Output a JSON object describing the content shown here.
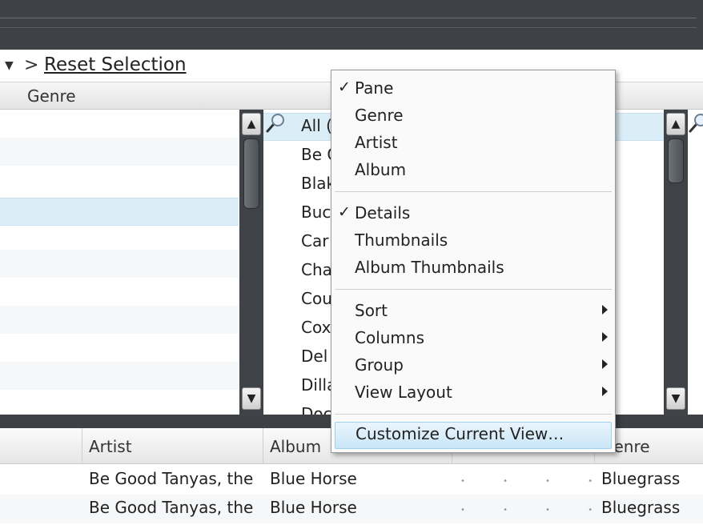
{
  "breadcrumb": {
    "separator": ">",
    "reset_label": "Reset Selection"
  },
  "panes": {
    "genre_header": "Genre",
    "artist_items": [
      "All (",
      "Be G",
      "Blak",
      "Buc",
      "Car",
      "Cha",
      "Cou",
      "Cox",
      "Del",
      "Dilla",
      "Doc"
    ]
  },
  "table": {
    "columns": [
      "Artist",
      "Album",
      "",
      "Genre"
    ],
    "rows": [
      {
        "artist": "Be Good Tanyas, the",
        "album": "Blue Horse",
        "rating_dots": "• • • • •",
        "genre": "Bluegrass"
      },
      {
        "artist": "Be Good Tanyas, the",
        "album": "Blue Horse",
        "rating_dots": "• • • • •",
        "genre": "Bluegrass"
      }
    ]
  },
  "context_menu": {
    "check_mark": "✓",
    "group1": [
      {
        "label": "Pane",
        "checked": true
      },
      {
        "label": "Genre",
        "checked": false
      },
      {
        "label": "Artist",
        "checked": false
      },
      {
        "label": "Album",
        "checked": false
      }
    ],
    "group2": [
      {
        "label": "Details",
        "checked": true
      },
      {
        "label": "Thumbnails",
        "checked": false
      },
      {
        "label": "Album Thumbnails",
        "checked": false
      }
    ],
    "group3": [
      {
        "label": "Sort",
        "submenu": true
      },
      {
        "label": "Columns",
        "submenu": true
      },
      {
        "label": "Group",
        "submenu": true
      },
      {
        "label": "View Layout",
        "submenu": true
      }
    ],
    "customize_label": "Customize Current View…"
  },
  "colors": {
    "chrome": "#3e4145",
    "selection": "#dbeef8",
    "menu_highlight": "#c9e6f7"
  },
  "icons": {
    "search": "search-icon",
    "scroll_up": "chevron-up-icon",
    "scroll_down": "chevron-down-icon",
    "dropdown": "dropdown-triangle-icon"
  }
}
